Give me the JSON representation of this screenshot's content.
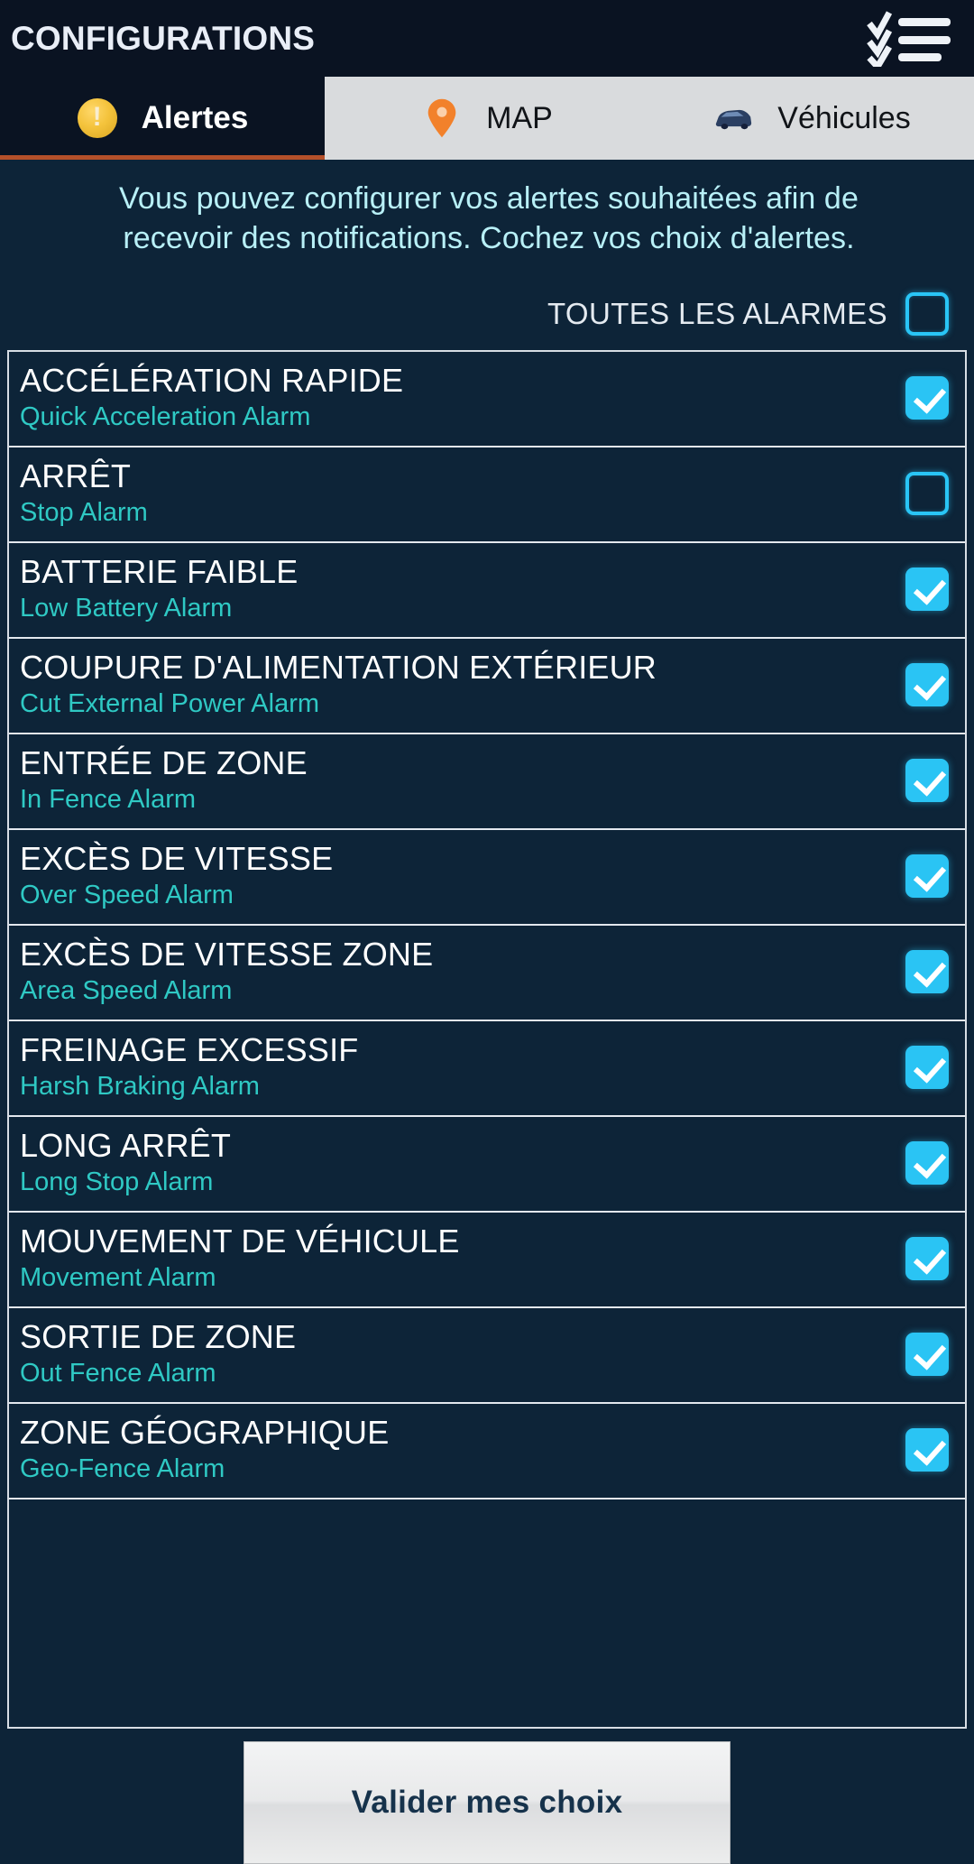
{
  "header": {
    "title": "CONFIGURATIONS",
    "menu_icon": "checklist-icon"
  },
  "tabs": [
    {
      "label": "Alertes",
      "icon": "warning-circle-icon",
      "active": true
    },
    {
      "label": "MAP",
      "icon": "map-pin-icon",
      "active": false
    },
    {
      "label": "Véhicules",
      "icon": "car-icon",
      "active": false
    }
  ],
  "description": {
    "line1": "Vous pouvez configurer vos alertes souhaitées afin de",
    "line2": "recevoir des notifications. Cochez vos choix d'alertes."
  },
  "all_alarms": {
    "label": "TOUTES LES ALARMES",
    "checked": false
  },
  "alarms": [
    {
      "fr": "ACCÉLÉRATION RAPIDE",
      "en": "Quick Acceleration Alarm",
      "checked": true
    },
    {
      "fr": "ARRÊT",
      "en": "Stop Alarm",
      "checked": false
    },
    {
      "fr": "BATTERIE FAIBLE",
      "en": "Low Battery Alarm",
      "checked": true
    },
    {
      "fr": "COUPURE D'ALIMENTATION EXTÉRIEUR",
      "en": "Cut External Power Alarm",
      "checked": true
    },
    {
      "fr": "ENTRÉE DE ZONE",
      "en": "In Fence Alarm",
      "checked": true
    },
    {
      "fr": "EXCÈS DE VITESSE",
      "en": "Over Speed Alarm",
      "checked": true
    },
    {
      "fr": "EXCÈS DE VITESSE ZONE",
      "en": "Area Speed Alarm",
      "checked": true
    },
    {
      "fr": "FREINAGE EXCESSIF",
      "en": "Harsh Braking Alarm",
      "checked": true
    },
    {
      "fr": "LONG ARRÊT",
      "en": "Long Stop Alarm",
      "checked": true
    },
    {
      "fr": "MOUVEMENT DE VÉHICULE",
      "en": "Movement Alarm",
      "checked": true
    },
    {
      "fr": "SORTIE DE ZONE",
      "en": "Out Fence Alarm",
      "checked": true
    },
    {
      "fr": "ZONE GÉOGRAPHIQUE",
      "en": "Geo-Fence Alarm",
      "checked": true
    }
  ],
  "footer": {
    "validate_label": "Valider mes choix"
  },
  "colors": {
    "background": "#0d2438",
    "topbar": "#0a1322",
    "accent_cyan": "#2ac4f4",
    "subtitle_teal": "#2fc9c4",
    "description_text": "#b8f0f7",
    "tab_inactive_bg": "#d9dbdd",
    "tab_active_underline": "#b5502a",
    "warning_amber": "#f4c33c",
    "map_pin_orange": "#f2812b"
  }
}
